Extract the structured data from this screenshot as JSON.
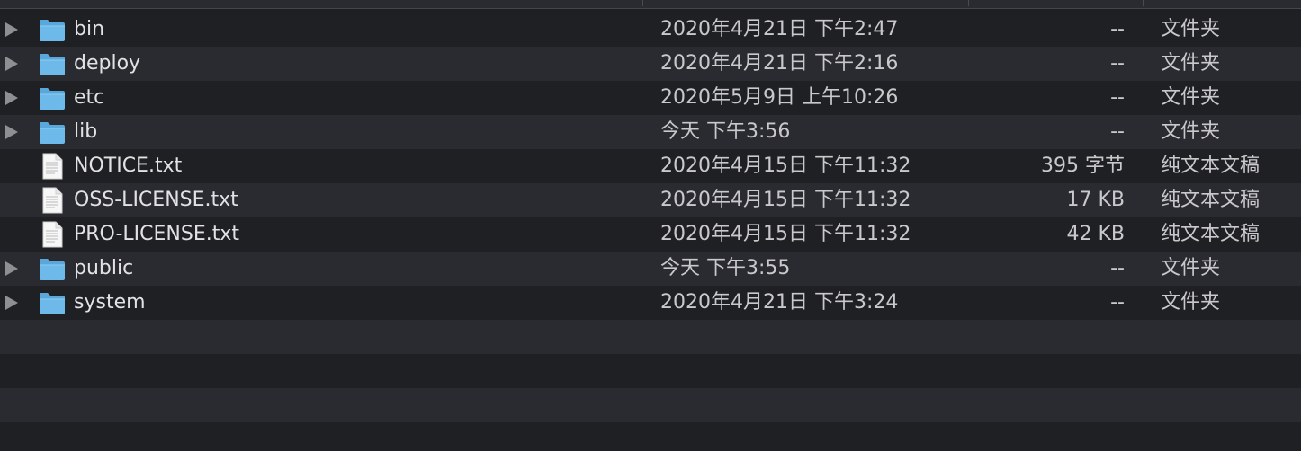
{
  "files": [
    {
      "name": "bin",
      "type": "folder",
      "date": "2020年4月21日 下午2:47",
      "size": "--",
      "kind": "文件夹",
      "icon": "folder-icon"
    },
    {
      "name": "deploy",
      "type": "folder",
      "date": "2020年4月21日 下午2:16",
      "size": "--",
      "kind": "文件夹",
      "icon": "folder-icon"
    },
    {
      "name": "etc",
      "type": "folder",
      "date": "2020年5月9日 上午10:26",
      "size": "--",
      "kind": "文件夹",
      "icon": "folder-icon"
    },
    {
      "name": "lib",
      "type": "folder",
      "date": "今天 下午3:56",
      "size": "--",
      "kind": "文件夹",
      "icon": "folder-icon"
    },
    {
      "name": "NOTICE.txt",
      "type": "file",
      "date": "2020年4月15日 下午11:32",
      "size": "395 字节",
      "kind": "纯文本文稿",
      "icon": "text-file-icon"
    },
    {
      "name": "OSS-LICENSE.txt",
      "type": "file",
      "date": "2020年4月15日 下午11:32",
      "size": "17 KB",
      "kind": "纯文本文稿",
      "icon": "text-file-icon"
    },
    {
      "name": "PRO-LICENSE.txt",
      "type": "file",
      "date": "2020年4月15日 下午11:32",
      "size": "42 KB",
      "kind": "纯文本文稿",
      "icon": "text-file-icon"
    },
    {
      "name": "public",
      "type": "folder",
      "date": "今天 下午3:55",
      "size": "--",
      "kind": "文件夹",
      "icon": "folder-icon"
    },
    {
      "name": "system",
      "type": "folder",
      "date": "2020年4月21日 下午3:24",
      "size": "--",
      "kind": "文件夹",
      "icon": "folder-icon"
    }
  ],
  "colors": {
    "background": "#1e1f23",
    "row_alt": "#2a2b30",
    "folder_blue": "#67b7e8",
    "text": "#e2e2e4"
  }
}
